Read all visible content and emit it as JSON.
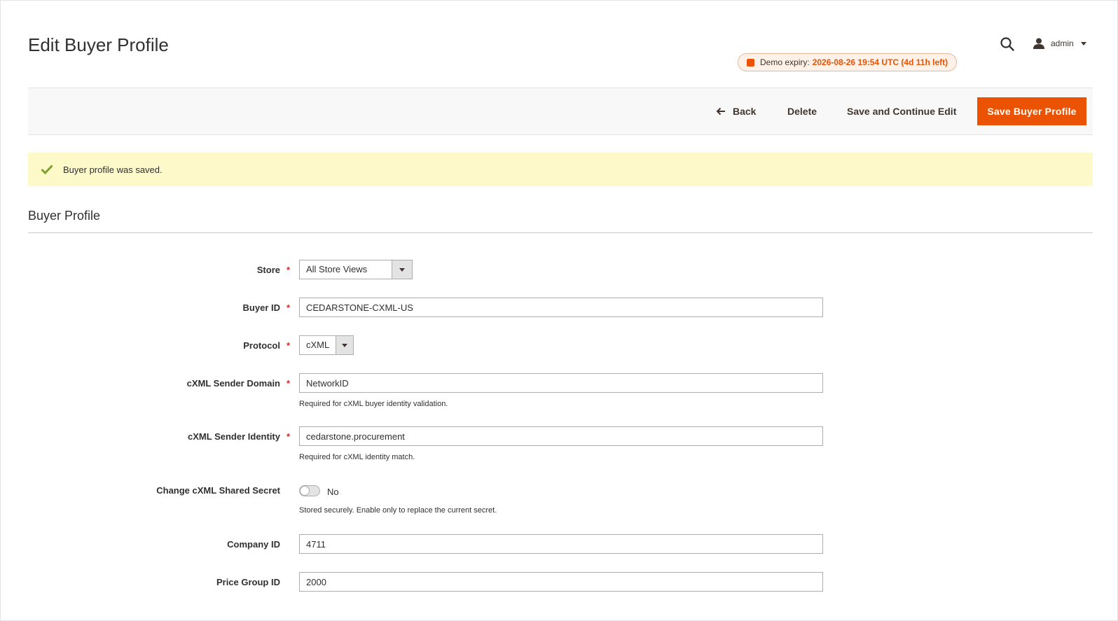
{
  "header": {
    "title": "Edit Buyer Profile",
    "user": "admin",
    "demo": {
      "label": "Demo expiry:",
      "value": "2026-08-26 19:54 UTC (4d 11h left)"
    }
  },
  "actions": {
    "back": "Back",
    "delete": "Delete",
    "save_continue": "Save and Continue Edit",
    "save": "Save Buyer Profile"
  },
  "message": {
    "text": "Buyer profile was saved."
  },
  "section": {
    "title": "Buyer Profile"
  },
  "form": {
    "store": {
      "label": "Store",
      "value": "All Store Views",
      "required": "*"
    },
    "buyer_id": {
      "label": "Buyer ID",
      "value": "CEDARSTONE-CXML-US",
      "required": "*"
    },
    "protocol": {
      "label": "Protocol",
      "value": "cXML",
      "required": "*"
    },
    "sender_domain": {
      "label": "cXML Sender Domain",
      "value": "NetworkID",
      "required": "*",
      "note": "Required for cXML buyer identity validation."
    },
    "sender_identity": {
      "label": "cXML Sender Identity",
      "value": "cedarstone.procurement",
      "required": "*",
      "note": "Required for cXML identity match."
    },
    "shared_secret": {
      "label": "Change cXML Shared Secret",
      "state": "No",
      "note": "Stored securely. Enable only to replace the current secret."
    },
    "company_id": {
      "label": "Company ID",
      "value": "4711"
    },
    "price_group_id": {
      "label": "Price Group ID",
      "value": "2000"
    }
  },
  "colors": {
    "accent": "#eb5202",
    "success_bg": "#fdf9c8",
    "success_icon": "#79a22e",
    "required": "#e22626"
  },
  "icons": {
    "search": "search-icon",
    "user": "user-icon",
    "back": "arrow-left-icon",
    "success": "check-icon"
  }
}
